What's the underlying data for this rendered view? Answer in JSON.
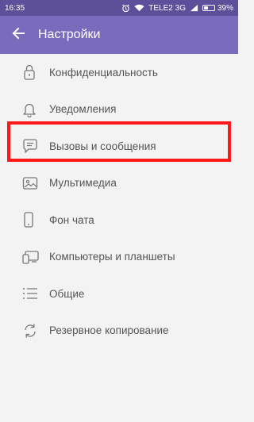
{
  "status_bar": {
    "time": "16:35",
    "carrier": "TELE2 3G",
    "battery": "39%",
    "battery_level": 0.39
  },
  "toolbar": {
    "title": "Настройки"
  },
  "menu": {
    "items": [
      {
        "label": "Конфиденциальность",
        "icon": "lock-icon"
      },
      {
        "label": "Уведомления",
        "icon": "bell-icon"
      },
      {
        "label": "Вызовы и сообщения",
        "icon": "chat-bubble-icon"
      },
      {
        "label": "Мультимедиа",
        "icon": "image-icon"
      },
      {
        "label": "Фон чата",
        "icon": "phone-icon"
      },
      {
        "label": "Компьютеры и планшеты",
        "icon": "devices-icon"
      },
      {
        "label": "Общие",
        "icon": "list-icon"
      },
      {
        "label": "Резервное копирование",
        "icon": "sync-icon"
      }
    ]
  },
  "colors": {
    "status_bar": "#5d4f9a",
    "toolbar": "#7b6bbd",
    "highlight": "#ff1a1a",
    "background": "#f3f3f3"
  }
}
